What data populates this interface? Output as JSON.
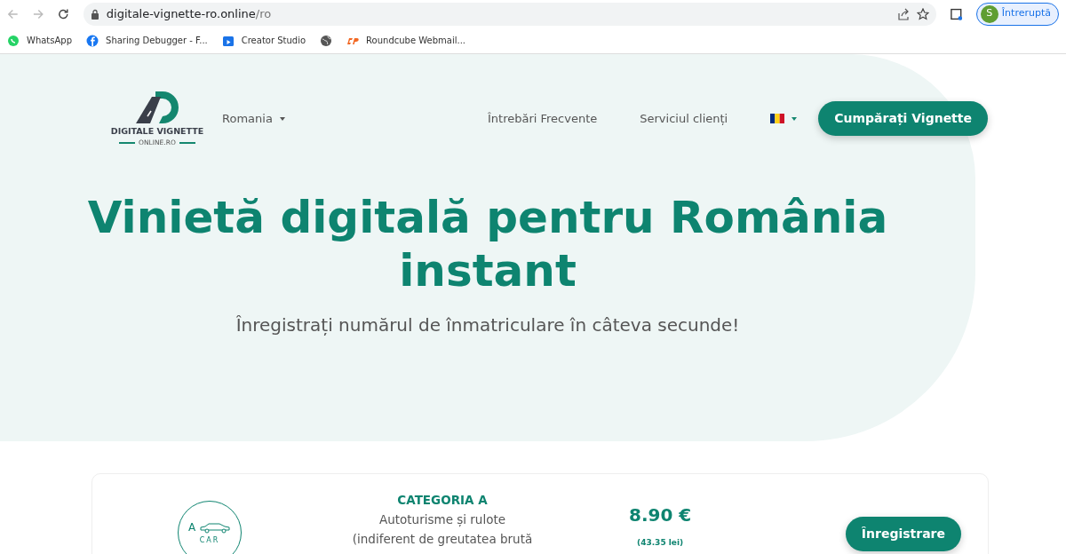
{
  "browser": {
    "url_host": "digitale-vignette-ro.online",
    "url_path": "/ro",
    "profile_initial": "S",
    "profile_status": "Întreruptă"
  },
  "bookmarks": [
    {
      "kind": "labeled",
      "label": "WhatsApp"
    },
    {
      "kind": "labeled",
      "label": "Sharing Debugger - F..."
    },
    {
      "kind": "labeled",
      "label": "Creator Studio"
    },
    {
      "kind": "icon_only"
    },
    {
      "kind": "labeled",
      "label": "Roundcube Webmail..."
    }
  ],
  "logo": {
    "line_1": "DIGITALE VIGNETTE",
    "line_2": "ONLINE.RO"
  },
  "nav": {
    "country": "Romania",
    "links": [
      "Întrebări Frecvente",
      "Serviciul clienți"
    ],
    "cta": "Cumpărați Vignette"
  },
  "hero": {
    "title": "Vinietă digitală pentru România instant",
    "subtitle": "Înregistrați numărul de înmatriculare în câteva secunde!"
  },
  "categories": [
    {
      "badge_letter": "A",
      "badge_label": "CAR",
      "title": "CATEGORIA A",
      "description_lines": [
        "Autoturisme și rulote",
        "(indiferent de greutatea brută"
      ],
      "price": "8.90 €",
      "price_local": "(43.35 lei)",
      "button": "Înregistrare"
    }
  ]
}
